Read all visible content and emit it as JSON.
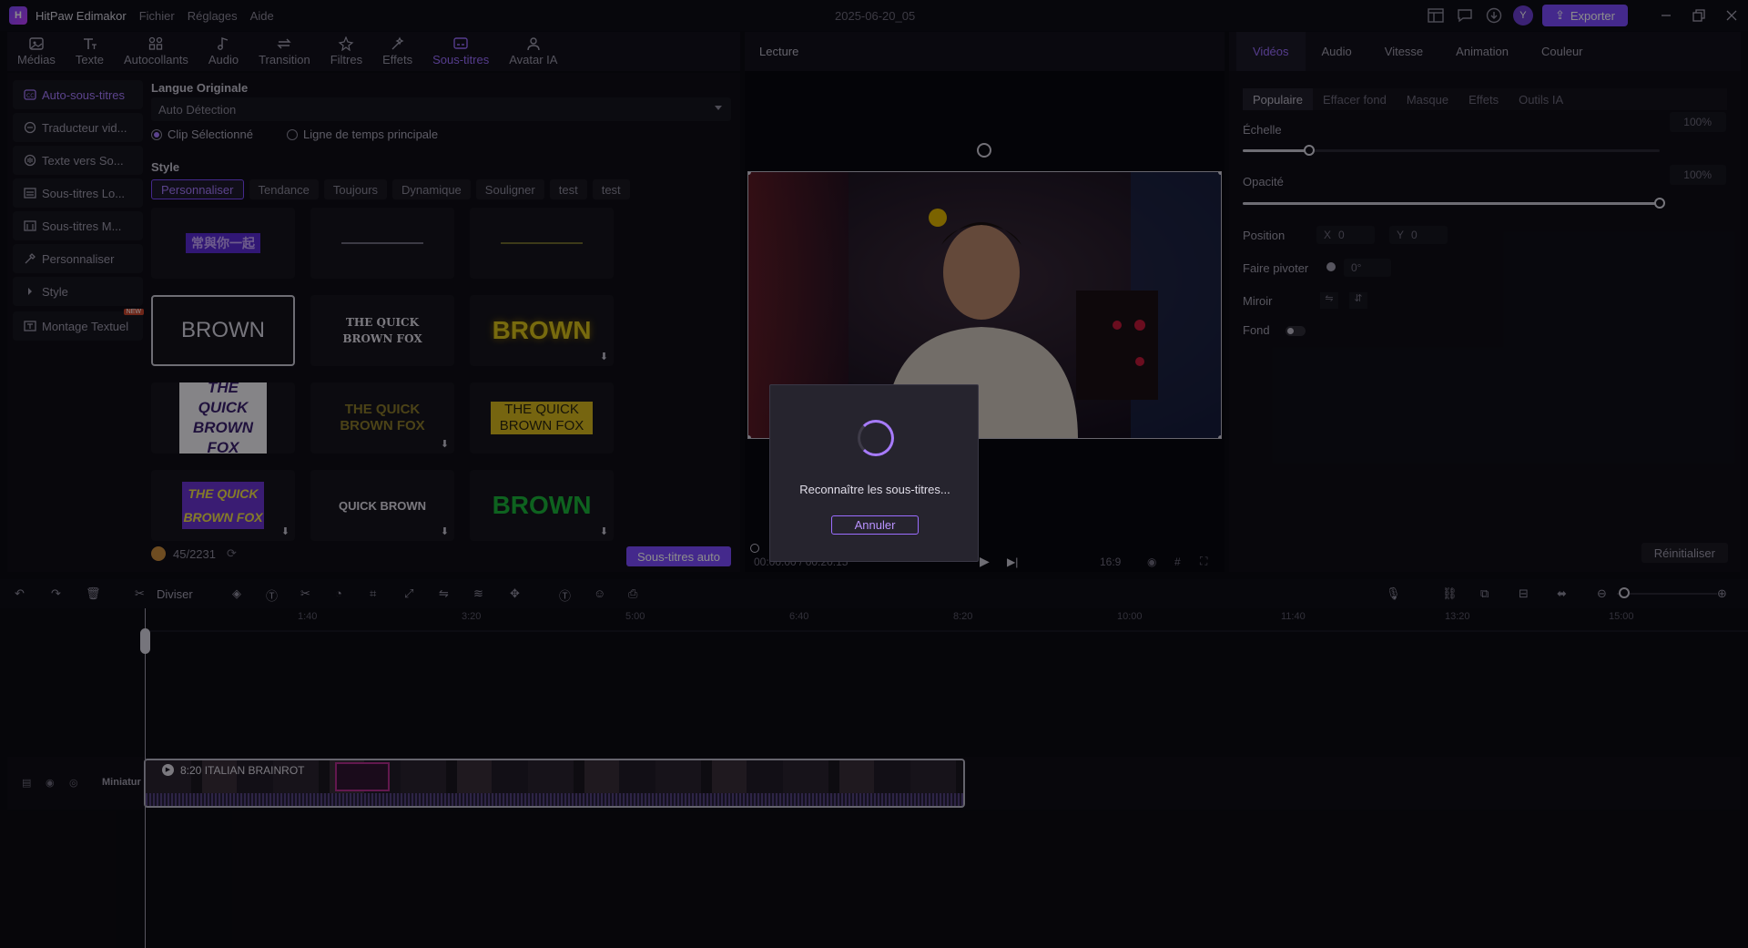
{
  "app": {
    "name": "HitPaw Edimakor",
    "document_title": "2025-06-20_05",
    "avatar_letter": "Y"
  },
  "menu": [
    "Fichier",
    "Réglages",
    "Aide"
  ],
  "export_label": "Exporter",
  "toolbar": [
    {
      "label": "Médias",
      "icon": "media-icon"
    },
    {
      "label": "Texte",
      "icon": "text-icon"
    },
    {
      "label": "Autocollants",
      "icon": "sticker-icon"
    },
    {
      "label": "Audio",
      "icon": "audio-icon"
    },
    {
      "label": "Transition",
      "icon": "transition-icon"
    },
    {
      "label": "Filtres",
      "icon": "filter-icon"
    },
    {
      "label": "Effets",
      "icon": "effects-icon"
    },
    {
      "label": "Sous-titres",
      "icon": "subtitles-icon",
      "active": true
    },
    {
      "label": "Avatar IA",
      "icon": "avatar-ai-icon"
    }
  ],
  "sidebar": [
    {
      "label": "Auto-sous-titres",
      "active": true
    },
    {
      "label": "Traducteur vid..."
    },
    {
      "label": "Texte vers So..."
    },
    {
      "label": "Sous-titres Lo..."
    },
    {
      "label": "Sous-titres M..."
    },
    {
      "label": "Personnaliser"
    },
    {
      "label": "Style"
    },
    {
      "label": "Montage Textuel",
      "badge": "NEW"
    }
  ],
  "subtitles": {
    "language_label": "Langue Originale",
    "language_value": "Auto Détection",
    "radio_clip": "Clip Sélectionné",
    "radio_timeline": "Ligne de temps principale",
    "style_label": "Style",
    "style_tabs": [
      "Personnaliser",
      "Tendance",
      "Toujours",
      "Dynamique",
      "Souligner",
      "test",
      "test"
    ],
    "tiles": [
      {
        "text": "常與你一起"
      },
      {
        "text": ""
      },
      {
        "text": ""
      },
      {
        "text": "BROWN"
      },
      {
        "text": "THE QUICK BROWN FOX"
      },
      {
        "text": "BROWN"
      },
      {
        "text": "THE QUICK BROWN FOX"
      },
      {
        "text": "THE QUICK BROWN FOX"
      },
      {
        "text": "THE QUICK BROWN FOX"
      },
      {
        "text": "THE QUICK BROWN FOX"
      },
      {
        "text": "QUICK BROWN"
      },
      {
        "text": "BROWN"
      }
    ],
    "credits": "45/2231",
    "auto_button": "Sous-titres auto"
  },
  "player": {
    "title": "Lecture",
    "time": "00:00:00 / 00:20:15",
    "aspect": "16:9"
  },
  "inspector": {
    "tabs": [
      "Vidéos",
      "Audio",
      "Vitesse",
      "Animation",
      "Couleur"
    ],
    "sub_tabs": [
      "Populaire",
      "Effacer fond",
      "Masque",
      "Effets",
      "Outils IA"
    ],
    "scale_label": "Échelle",
    "scale_value": "100%",
    "scale_level": 0.16,
    "opacity_label": "Opacité",
    "opacity_value": "100%",
    "opacity_level": 1.0,
    "position_label": "Position",
    "pos_x_label": "X",
    "pos_x": "0",
    "pos_y_label": "Y",
    "pos_y": "0",
    "rotate_label": "Faire pivoter",
    "rotate_value": "0°",
    "mirror_label": "Miroir",
    "background_label": "Fond",
    "reset_label": "Réinitialiser"
  },
  "timeline": {
    "split_label": "Diviser",
    "ticks": [
      "1:40",
      "3:20",
      "5:00",
      "6:40",
      "8:20",
      "10:00",
      "11:40",
      "13:20",
      "15:00"
    ],
    "track_label": "Miniatur",
    "clip_name": "8:20 ITALIAN BRAINROT"
  },
  "modal": {
    "message": "Reconnaître les sous-titres...",
    "cancel": "Annuler"
  },
  "colors": {
    "accent": "#7d4cff",
    "accent_text": "#9b6dff",
    "background": "#0c0b13"
  }
}
